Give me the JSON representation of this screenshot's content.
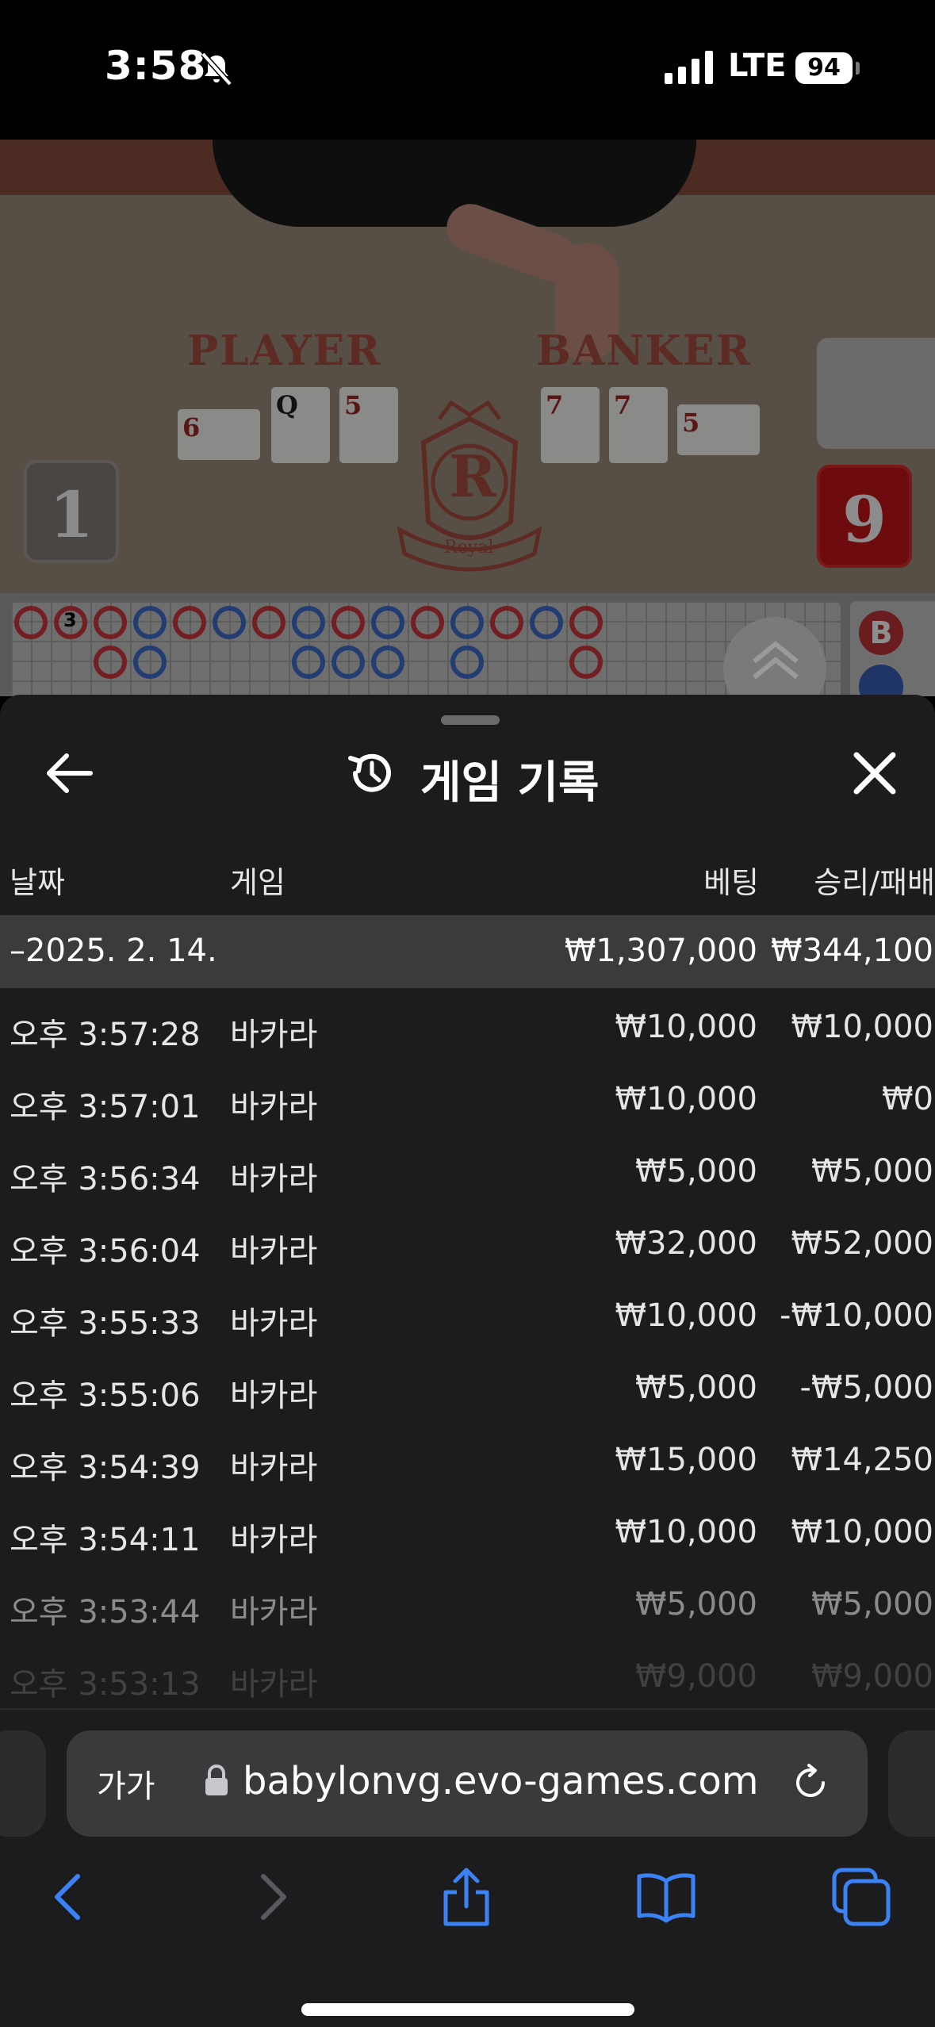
{
  "status_bar": {
    "time": "3:58",
    "network": "LTE",
    "battery": "94"
  },
  "game": {
    "player_label": "PLAYER",
    "banker_label": "BANKER",
    "player_score": "1",
    "banker_score": "9",
    "player_cards": [
      "6",
      "Q",
      "5"
    ],
    "banker_cards": [
      "7",
      "7",
      "5"
    ],
    "logo_letter": "R",
    "logo_text": "Royal",
    "roadmap_b": "B",
    "roadmap_marker": "3"
  },
  "history": {
    "title": "게임 기록",
    "columns": {
      "date": "날짜",
      "game": "게임",
      "bet": "베팅",
      "result": "승리/패배"
    },
    "date_group": {
      "date": "–2025. 2. 14.",
      "bet_total": "₩1,307,000",
      "result_total": "₩344,100"
    },
    "rows": [
      {
        "time": "오후 3:57:28",
        "game": "바카라",
        "bet": "₩10,000",
        "result": "₩10,000"
      },
      {
        "time": "오후 3:57:01",
        "game": "바카라",
        "bet": "₩10,000",
        "result": "₩0"
      },
      {
        "time": "오후 3:56:34",
        "game": "바카라",
        "bet": "₩5,000",
        "result": "₩5,000"
      },
      {
        "time": "오후 3:56:04",
        "game": "바카라",
        "bet": "₩32,000",
        "result": "₩52,000"
      },
      {
        "time": "오후 3:55:33",
        "game": "바카라",
        "bet": "₩10,000",
        "result": "-₩10,000"
      },
      {
        "time": "오후 3:55:06",
        "game": "바카라",
        "bet": "₩5,000",
        "result": "-₩5,000"
      },
      {
        "time": "오후 3:54:39",
        "game": "바카라",
        "bet": "₩15,000",
        "result": "₩14,250"
      },
      {
        "time": "오후 3:54:11",
        "game": "바카라",
        "bet": "₩10,000",
        "result": "₩10,000"
      },
      {
        "time": "오후 3:53:44",
        "game": "바카라",
        "bet": "₩5,000",
        "result": "₩5,000"
      },
      {
        "time": "오후 3:53:13",
        "game": "바카라",
        "bet": "₩9,000",
        "result": "₩9,000"
      }
    ]
  },
  "browser": {
    "text_size_label": "가가",
    "url": "babylonvg.evo-games.com"
  },
  "icons": {
    "back": "arrow-left-icon",
    "close": "close-icon",
    "history": "history-icon",
    "lock": "lock-icon",
    "reload": "reload-icon",
    "nav_back": "chevron-left-icon",
    "nav_forward": "chevron-right-icon",
    "share": "share-icon",
    "bookmarks": "book-icon",
    "tabs": "tabs-icon"
  },
  "colors": {
    "sheet_bg": "#1c1c1e",
    "accent_blue": "#3b82f6",
    "banker_red": "#6e0b0f",
    "player_blue": "#233d73"
  }
}
